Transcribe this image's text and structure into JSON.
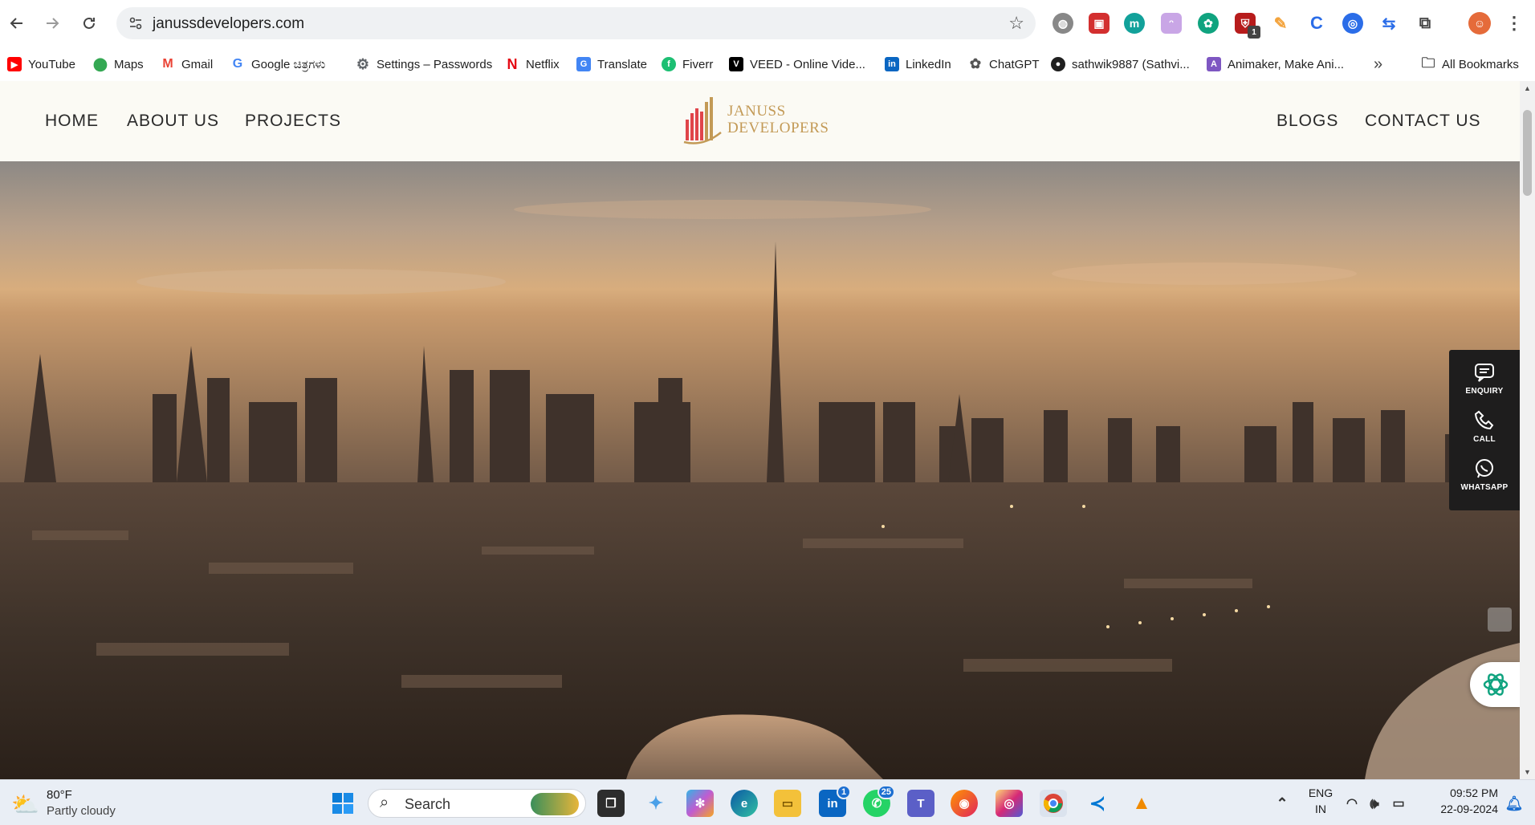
{
  "browser": {
    "url": "janussdevelopers.com",
    "bookmarks": [
      {
        "label": "YouTube",
        "icon": "youtube-icon",
        "color": "#ff0000"
      },
      {
        "label": "Maps",
        "icon": "maps-icon",
        "color": "#34a853"
      },
      {
        "label": "Gmail",
        "icon": "gmail-icon",
        "color": "#ea4335"
      },
      {
        "label": "Google ಚಿತ್ರಗಳು",
        "icon": "google-icon",
        "color": "#4285f4"
      },
      {
        "label": "Settings – Passwords",
        "icon": "gear-icon",
        "color": "#5f6368"
      },
      {
        "label": "Netflix",
        "icon": "netflix-icon",
        "color": "#e50914"
      },
      {
        "label": "Translate",
        "icon": "translate-icon",
        "color": "#4285f4"
      },
      {
        "label": "Fiverr",
        "icon": "fiverr-icon",
        "color": "#1dbf73"
      },
      {
        "label": "VEED - Online Vide...",
        "icon": "veed-icon",
        "color": "#000000"
      },
      {
        "label": "LinkedIn",
        "icon": "linkedin-icon",
        "color": "#0a66c2"
      },
      {
        "label": "ChatGPT",
        "icon": "chatgpt-icon",
        "color": "#555555"
      },
      {
        "label": "sathwik9887 (Sathvi...",
        "icon": "github-icon",
        "color": "#1f1f1f"
      },
      {
        "label": "Animaker, Make Ani...",
        "icon": "animaker-icon",
        "color": "#7e57c2"
      }
    ],
    "all_bookmarks_label": "All Bookmarks",
    "extension_badge": "1"
  },
  "site": {
    "nav_left": [
      "HOME",
      "ABOUT US",
      "PROJECTS"
    ],
    "nav_right": [
      "BLOGS",
      "CONTACT US"
    ],
    "logo_line1": "JANUSS",
    "logo_line2": "DEVELOPERS",
    "side_actions": [
      "ENQUIRY",
      "CALL",
      "WHATSAPP"
    ]
  },
  "taskbar": {
    "weather_temp": "80°F",
    "weather_desc": "Partly cloudy",
    "search_label": "Search",
    "linkedin_badge": "1",
    "whatsapp_badge": "25",
    "lang_line1": "ENG",
    "lang_line2": "IN",
    "time": "09:52 PM",
    "date": "22-09-2024"
  },
  "colors": {
    "header_bg": "#fbfaf4",
    "logo_gold": "#c39a56",
    "side_bar_bg": "#1e1d1d"
  }
}
